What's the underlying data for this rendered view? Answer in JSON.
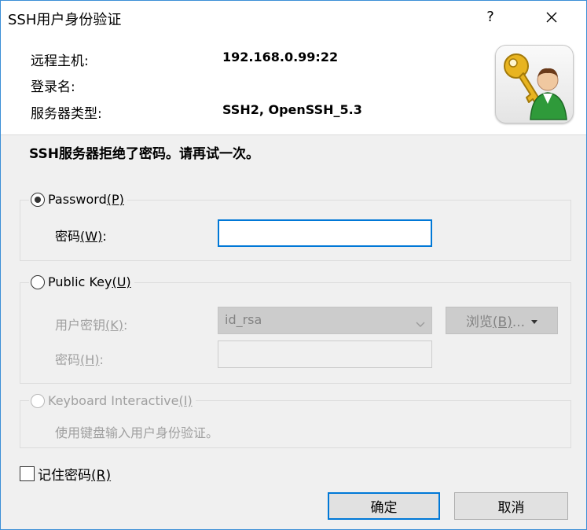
{
  "dialog": {
    "title": "SSH用户身份验证",
    "help_label": "?",
    "close_label": "✕"
  },
  "header": {
    "remote_host_label": "远程主机:",
    "remote_host_value": "192.168.0.99:22",
    "login_name_label": "登录名:",
    "login_name_value": "",
    "server_type_label": "服务器类型:",
    "server_type_value": "SSH2, OpenSSH_5.3",
    "icon": "key-user-icon"
  },
  "message": "SSH服务器拒绝了密码。请再试一次。",
  "password_group": {
    "radio_text": "Password",
    "radio_hotkey": "(P)",
    "selected": true,
    "password_label": "密码",
    "password_hotkey": "(W)",
    "password_suffix": ":",
    "password_value": ""
  },
  "publickey_group": {
    "radio_text": "Public Key",
    "radio_hotkey": "(U)",
    "selected": false,
    "user_key_label": "用户密钥",
    "user_key_hotkey": "(K)",
    "user_key_suffix": ":",
    "user_key_value": "id_rsa",
    "browse_label": "浏览",
    "browse_hotkey": "(B)",
    "browse_suffix": "...",
    "passphrase_label": "密码",
    "passphrase_hotkey": "(H)",
    "passphrase_suffix": ":",
    "passphrase_value": ""
  },
  "keyboard_group": {
    "radio_text": "Keyboard Interactive",
    "radio_hotkey": "(I)",
    "selected": false,
    "description": "使用键盘输入用户身份验证。"
  },
  "remember": {
    "label": "记住密码",
    "hotkey": "(R)",
    "checked": false
  },
  "buttons": {
    "ok": "确定",
    "cancel": "取消"
  },
  "colors": {
    "accent": "#0078d7",
    "window_border": "#3b8fd6",
    "background": "#f0f0f0"
  }
}
